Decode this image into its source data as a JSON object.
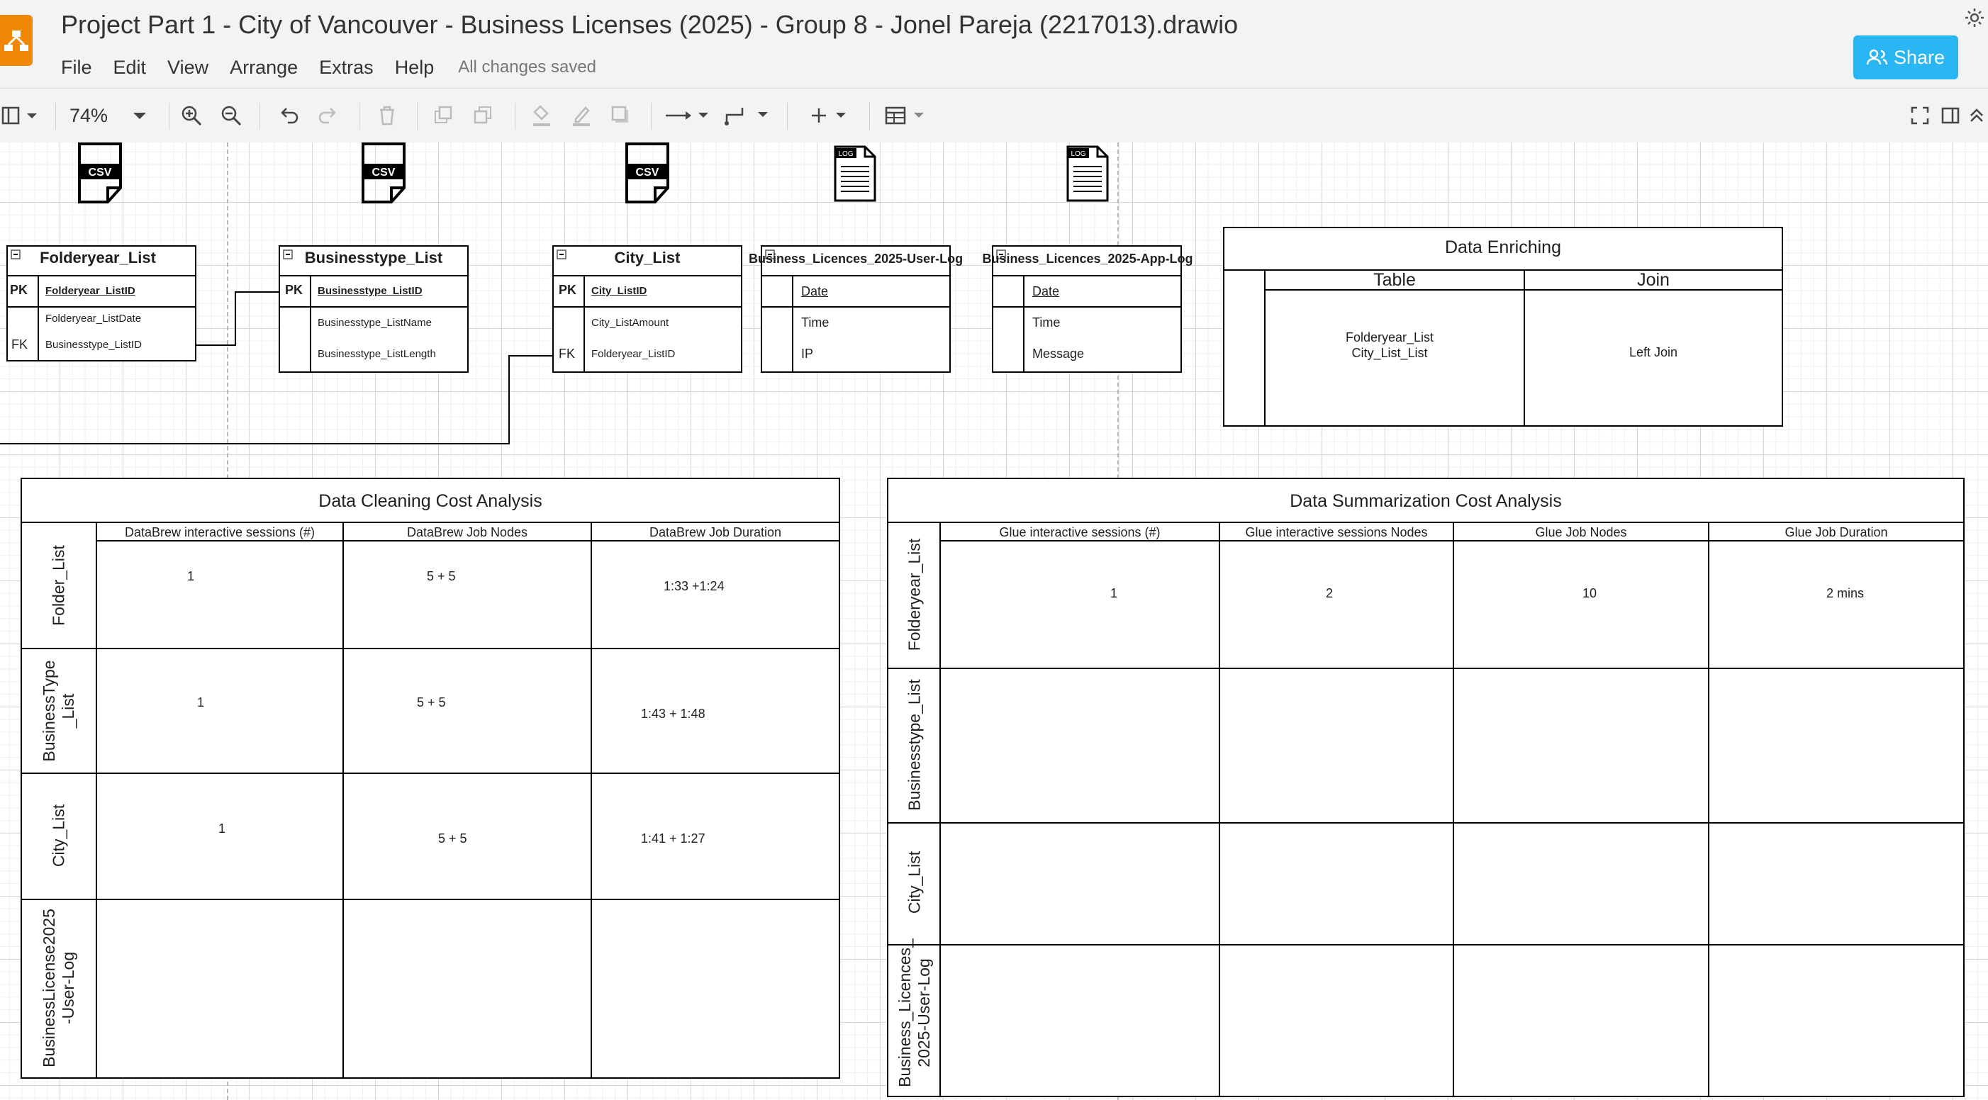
{
  "window": {
    "title": "Project Part 1 - City of Vancouver - Business Licenses (2025) - Group 8 - Jonel Pareja (2217013).drawio",
    "menus": [
      "File",
      "Edit",
      "View",
      "Arrange",
      "Extras",
      "Help"
    ],
    "save_status": "All changes saved",
    "share_label": "Share",
    "accent_color": "#29b6f2",
    "logo_color": "#f08705"
  },
  "toolbar": {
    "zoom": "74%",
    "icons": [
      "panel-toggle-icon",
      "zoom-in-icon",
      "zoom-out-icon",
      "undo-icon",
      "redo-icon",
      "delete-icon",
      "to-front-icon",
      "to-back-icon",
      "fill-color-icon",
      "line-color-icon",
      "shadow-icon",
      "connection-icon",
      "waypoints-icon",
      "insert-icon",
      "table-icon",
      "fullscreen-icon",
      "format-panel-icon",
      "collapse-icon"
    ]
  },
  "diagram": {
    "file_icons": [
      {
        "label": "CSV"
      },
      {
        "label": "CSV"
      },
      {
        "label": "CSV"
      },
      {
        "label": "LOG"
      },
      {
        "label": "LOG"
      }
    ],
    "entities": [
      {
        "title": "Folderyear_List",
        "rows": [
          {
            "key": "PK",
            "field": "Folderyear_ListID"
          },
          {
            "key": "",
            "field": "Folderyear_ListDate"
          },
          {
            "key": "FK",
            "field": "Businesstype_ListID"
          }
        ]
      },
      {
        "title": "Businesstype_List",
        "rows": [
          {
            "key": "PK",
            "field": "Businesstype_ListID"
          },
          {
            "key": "",
            "field": "Businesstype_ListName"
          },
          {
            "key": "",
            "field": "Businesstype_ListLength"
          }
        ]
      },
      {
        "title": "City_List",
        "rows": [
          {
            "key": "PK",
            "field": "City_ListID"
          },
          {
            "key": "",
            "field": "City_ListAmount"
          },
          {
            "key": "FK",
            "field": "Folderyear_ListID"
          }
        ]
      },
      {
        "title": "Business_Licences_2025-User-Log",
        "rows": [
          {
            "key": "",
            "field": "Date"
          },
          {
            "key": "",
            "field": "Time"
          },
          {
            "key": "",
            "field": "IP"
          }
        ]
      },
      {
        "title": "Business_Licences_2025-App-Log",
        "rows": [
          {
            "key": "",
            "field": "Date"
          },
          {
            "key": "",
            "field": "Time"
          },
          {
            "key": "",
            "field": "Message"
          }
        ]
      }
    ],
    "enriching": {
      "title": "Data Enriching",
      "columns": [
        "Table",
        "Join"
      ],
      "table_cell": "Folderyear_List\nCity_List_List",
      "join_cell": "Left Join"
    },
    "cleaning": {
      "title": "Data Cleaning Cost Analysis",
      "columns": [
        "DataBrew interactive sessions (#)",
        "DataBrew Job Nodes",
        "DataBrew Job Duration"
      ],
      "rows": [
        "Folder_List",
        "BusinessType\n_List",
        "City_List",
        "BusinessLicense2025\n-User-Log"
      ],
      "cells": [
        [
          "1",
          "5 + 5",
          "1:33 +1:24"
        ],
        [
          "1",
          "5 + 5",
          "1:43 + 1:48"
        ],
        [
          "1",
          "5 + 5",
          "1:41 + 1:27"
        ],
        [
          "",
          "",
          ""
        ]
      ]
    },
    "summarization": {
      "title": "Data Summarization Cost Analysis",
      "columns": [
        "Glue interactive sessions (#)",
        "Glue interactive sessions Nodes",
        "Glue Job Nodes",
        "Glue Job Duration"
      ],
      "rows": [
        "Folderyear_List",
        "Businesstype_List",
        "City_List",
        "Business_Licences_\n2025-User-Log"
      ],
      "cells": [
        [
          "1",
          "2",
          "10",
          "2 mins"
        ],
        [
          "",
          "",
          "",
          ""
        ],
        [
          "",
          "",
          "",
          ""
        ],
        [
          "",
          "",
          "",
          ""
        ]
      ]
    }
  }
}
